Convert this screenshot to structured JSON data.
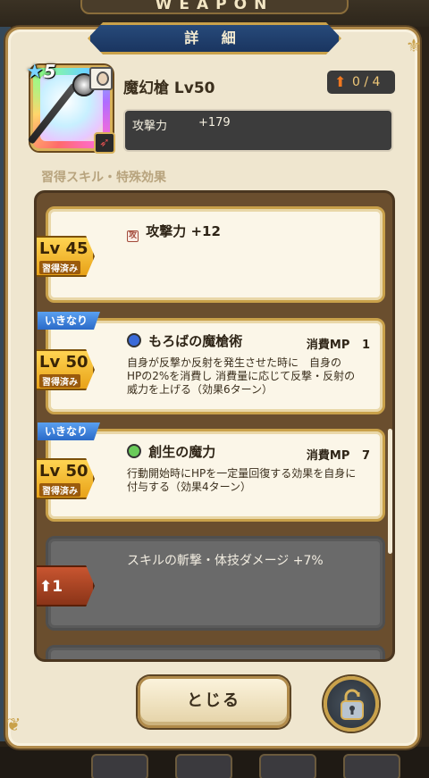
{
  "header": {
    "banner_text": "WEAPON",
    "title": "詳 細"
  },
  "weapon": {
    "rarity": "5",
    "name": "魔幻槍 Lv50",
    "upgrade": "0 / 4",
    "stat_label": "攻撃力",
    "stat_value": "+179"
  },
  "section_label": "習得スキル・特殊効果",
  "cards": [
    {
      "lv": "Lv 45",
      "status": "習得済み",
      "title": "攻撃力 +12",
      "icon": "attack-stat-icon"
    },
    {
      "tag": "いきなり",
      "lv": "Lv 50",
      "status": "習得済み",
      "title": "もろばの魔槍術",
      "mp_label": "消費MP",
      "mp_value": "1",
      "icon": "blue-skill-icon",
      "desc_lines": [
        "自身が反撃か反射を発生させた時に　自身の",
        "HPの2%を消費し 消費量に応じて反撃・反射の",
        "威力を上げる（効果6ターン）"
      ]
    },
    {
      "tag": "いきなり",
      "lv": "Lv 50",
      "status": "習得済み",
      "title": "創生の魔力",
      "mp_label": "消費MP",
      "mp_value": "7",
      "icon": "green-skill-icon",
      "desc_lines": [
        "行動開始時にHPを一定量回復する効果を自身に",
        "付与する（効果4ターン）"
      ]
    },
    {
      "lv": "1",
      "title": "スキルの斬撃・体技ダメージ +7%",
      "locked": true
    }
  ],
  "buttons": {
    "close": "とじる"
  },
  "colors": {
    "accent_gold": "#c9a14a",
    "plate_blue": "#274a7a",
    "panel": "#efe6cf"
  }
}
